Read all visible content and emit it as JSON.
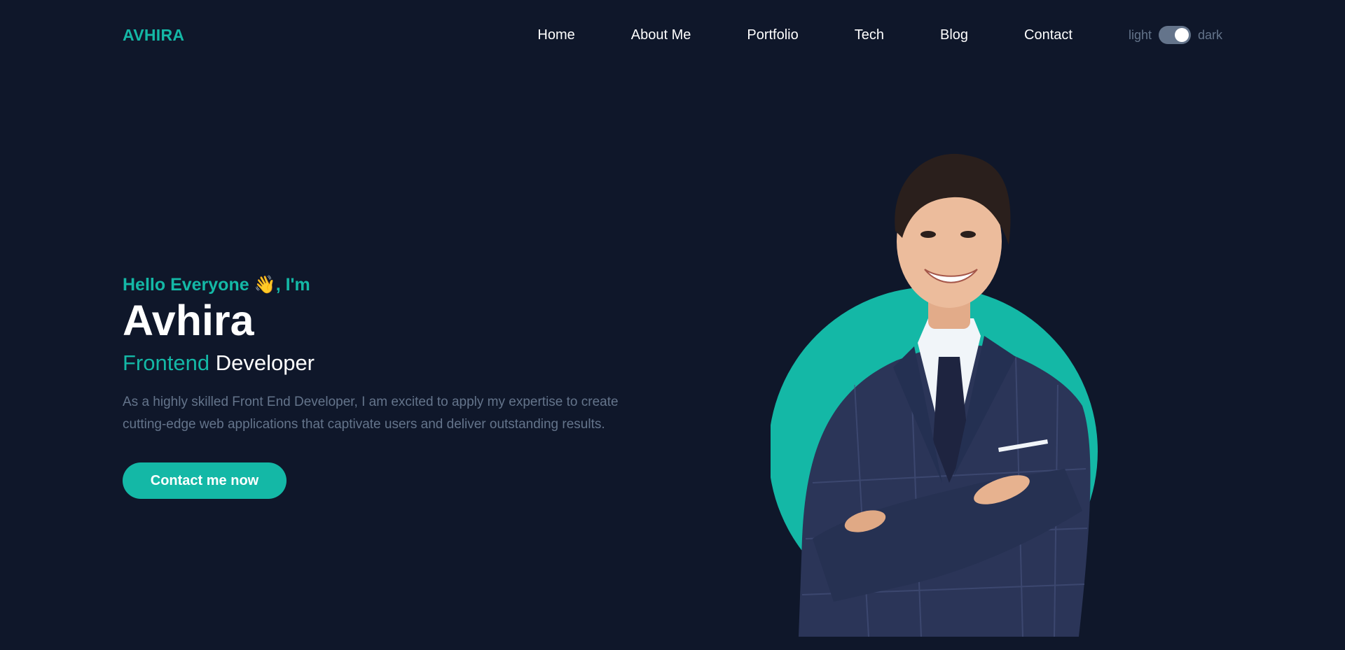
{
  "nav": {
    "logo": "AVHIRA",
    "items": [
      "Home",
      "About Me",
      "Portfolio",
      "Tech",
      "Blog",
      "Contact"
    ],
    "theme": {
      "light_label": "light",
      "dark_label": "dark",
      "mode": "dark"
    }
  },
  "hero": {
    "greeting_prefix": "Hello Everyone ",
    "greeting_emoji": "👋",
    "greeting_suffix": ", I'm",
    "name": "Avhira",
    "role_accent": "Frontend",
    "role_rest": "Developer",
    "description_line1": "As a highly skilled Front End Developer, I am excited to apply my expertise to create",
    "description_line2": "cutting-edge web applications that captivate users and deliver outstanding results.",
    "cta_label": "Contact me now"
  },
  "colors": {
    "background": "#0f172a",
    "accent": "#14b8a6",
    "muted": "#64748b",
    "text": "#ffffff"
  }
}
